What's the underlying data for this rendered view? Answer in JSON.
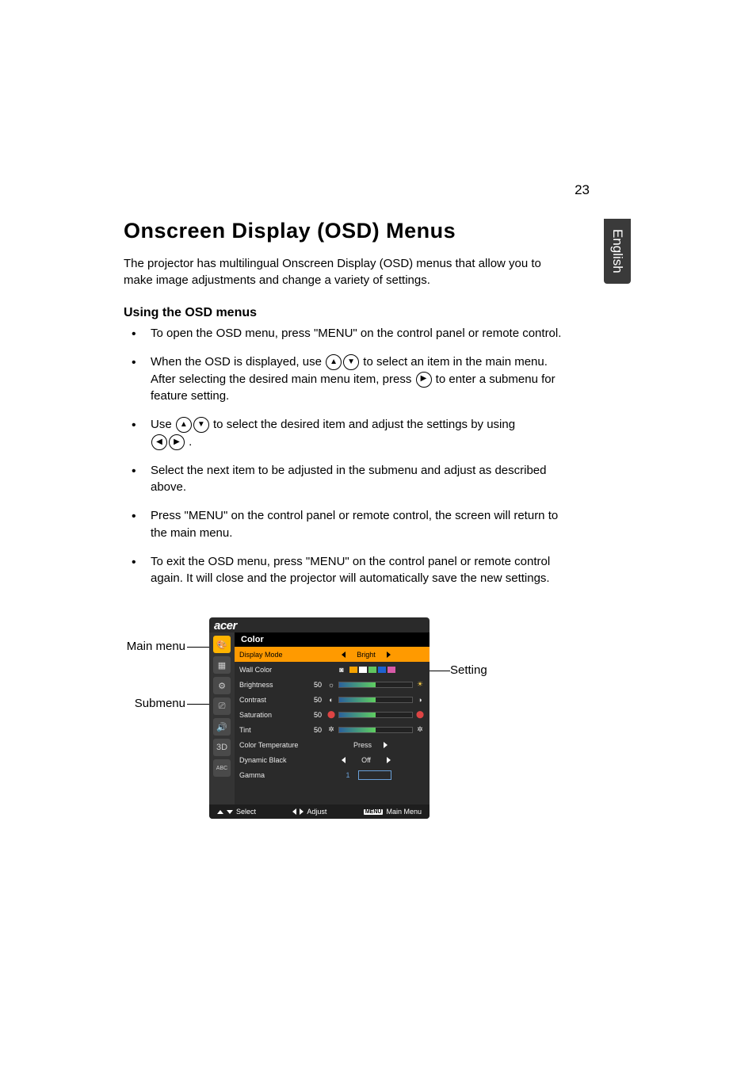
{
  "page_number": "23",
  "language_tab": "English",
  "heading": "Onscreen Display (OSD) Menus",
  "intro": "The projector has multilingual Onscreen Display (OSD) menus that allow you to make image adjustments and change a variety of settings.",
  "subheading": "Using the OSD menus",
  "bullets": {
    "b1": "To open the OSD menu, press \"MENU\" on the control panel or remote control.",
    "b2a": "When the OSD is displayed, use ",
    "b2b": " to select an item in the main menu. After selecting the desired main menu item, press ",
    "b2c": " to enter a submenu for feature setting.",
    "b3a": "Use ",
    "b3b": " to select the desired item and adjust the settings by using ",
    "b3c": ".",
    "b4": "Select the next item to be adjusted in the submenu and adjust as described above.",
    "b5": "Press \"MENU\" on the control panel or remote control, the screen will return to the main menu.",
    "b6": "To exit the OSD menu, press \"MENU\" on the control panel or remote control again. It will close and the projector will automatically save the new settings."
  },
  "diagram_labels": {
    "main_menu": "Main menu",
    "submenu": "Submenu",
    "setting": "Setting"
  },
  "osd": {
    "brand": "acer",
    "title": "Color",
    "side_icons": [
      "palette",
      "image",
      "gear",
      "management",
      "audio",
      "3d",
      "language"
    ],
    "rows": {
      "display_mode": {
        "label": "Display Mode",
        "value": "Bright"
      },
      "wall_color": {
        "label": "Wall Color"
      },
      "brightness": {
        "label": "Brightness",
        "value": "50"
      },
      "contrast": {
        "label": "Contrast",
        "value": "50"
      },
      "saturation": {
        "label": "Saturation",
        "value": "50"
      },
      "tint": {
        "label": "Tint",
        "value": "50"
      },
      "color_temp": {
        "label": "Color Temperature",
        "value": "Press"
      },
      "dyn_black": {
        "label": "Dynamic Black",
        "value": "Off"
      },
      "gamma": {
        "label": "Gamma",
        "value": "1"
      }
    },
    "swatches": [
      "#f5a300",
      "#ffffff",
      "#60c560",
      "#1e62d0",
      "#d85aa8"
    ],
    "footer": {
      "select": "Select",
      "adjust": "Adjust",
      "menu_key": "MENU",
      "main_menu": "Main Menu"
    }
  }
}
